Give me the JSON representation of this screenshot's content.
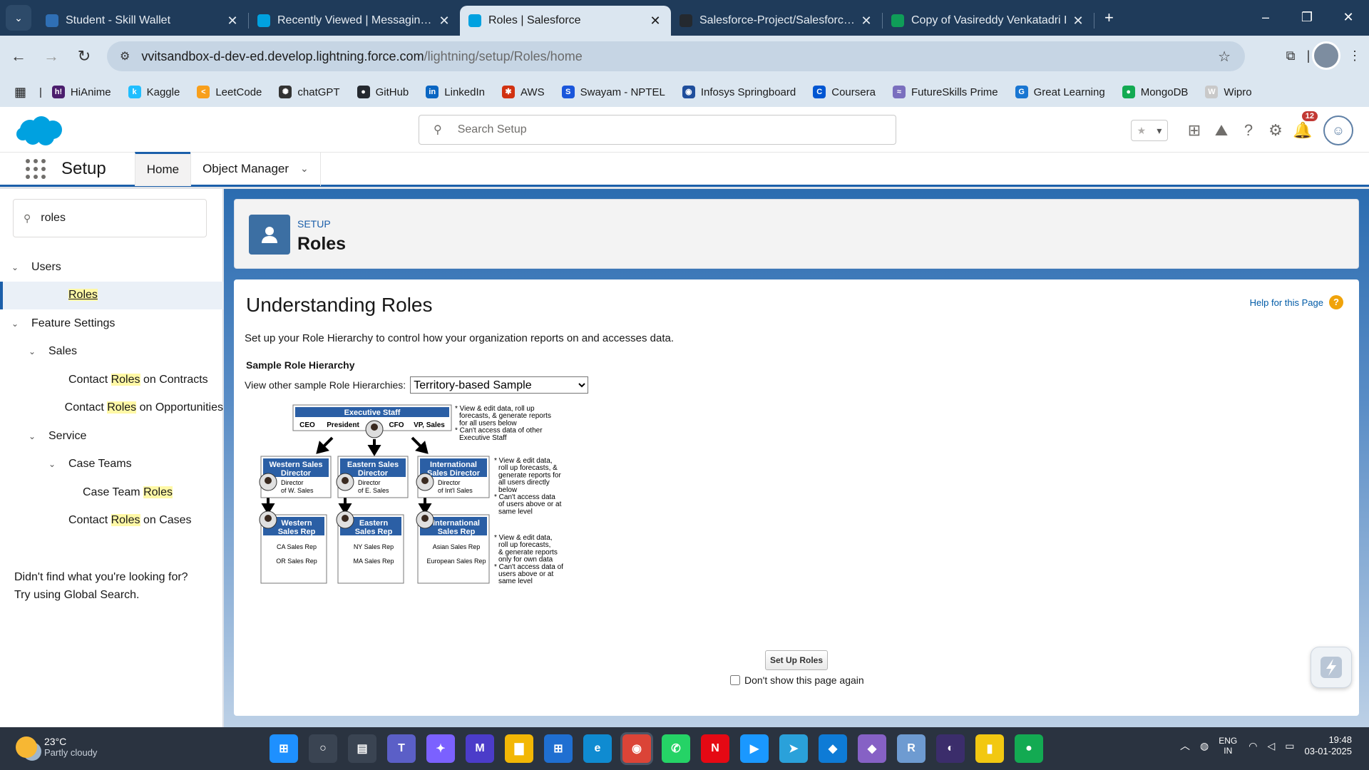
{
  "browser": {
    "tabs": [
      {
        "title": "Student - Skill Wallet",
        "color": "#2f6fb5"
      },
      {
        "title": "Recently Viewed | Messaging U",
        "color": "#00a1e0"
      },
      {
        "title": "Roles | Salesforce",
        "color": "#00a1e0",
        "active": true
      },
      {
        "title": "Salesforce-Project/Salesforce P",
        "color": "#24292f"
      },
      {
        "title": "Copy of Vasireddy Venkatadri I",
        "color": "#0f9d58"
      }
    ],
    "new_tab": "+",
    "url_host": "vvitsandbox-d-dev-ed.develop.lightning.force.com",
    "url_path": "/lightning/setup/Roles/home",
    "bookmarks": [
      {
        "label": "HiAnime",
        "color": "#4b1e6d",
        "icon": "h!"
      },
      {
        "label": "Kaggle",
        "color": "#20beff",
        "icon": "k"
      },
      {
        "label": "LeetCode",
        "color": "#f89f1b",
        "icon": "<"
      },
      {
        "label": "chatGPT",
        "color": "#333333",
        "icon": "✺"
      },
      {
        "label": "GitHub",
        "color": "#24292f",
        "icon": "●"
      },
      {
        "label": "LinkedIn",
        "color": "#0a66c2",
        "icon": "in"
      },
      {
        "label": "AWS",
        "color": "#d13212",
        "icon": "✱"
      },
      {
        "label": "Swayam - NPTEL",
        "color": "#1a56db",
        "icon": "S"
      },
      {
        "label": "Infosys Springboard",
        "color": "#1f4e9c",
        "icon": "◉"
      },
      {
        "label": "Coursera",
        "color": "#0056d2",
        "icon": "C"
      },
      {
        "label": "FutureSkills Prime",
        "color": "#7a6fbe",
        "icon": "≈"
      },
      {
        "label": "Great Learning",
        "color": "#1976d2",
        "icon": "G"
      },
      {
        "label": "MongoDB",
        "color": "#13aa52",
        "icon": "●"
      },
      {
        "label": "Wipro",
        "color": "#c9c9c9",
        "icon": "W"
      }
    ]
  },
  "salesforce": {
    "search_placeholder": "Search Setup",
    "notification_count": "12",
    "app_name": "Setup",
    "nav_tabs": [
      {
        "label": "Home"
      },
      {
        "label": "Object Manager"
      }
    ]
  },
  "sidebar": {
    "quick_find_value": "roles",
    "tree": [
      {
        "level": 0,
        "toggle": "⌄",
        "pre": "Users",
        "hl": "",
        "post": ""
      },
      {
        "level": 2,
        "toggle": "",
        "pre": "",
        "hl": "Roles",
        "post": "",
        "selected": true
      },
      {
        "level": 0,
        "toggle": "⌄",
        "pre": "Feature Settings",
        "hl": "",
        "post": ""
      },
      {
        "level": 1,
        "toggle": "⌄",
        "pre": "Sales",
        "hl": "",
        "post": ""
      },
      {
        "level": 2,
        "toggle": "",
        "pre": "Contact ",
        "hl": "Roles",
        "post": " on Contracts"
      },
      {
        "level": 2,
        "toggle": "",
        "pre": "Contact ",
        "hl": "Roles",
        "post": " on Opportunities"
      },
      {
        "level": 1,
        "toggle": "⌄",
        "pre": "Service",
        "hl": "",
        "post": ""
      },
      {
        "level": 2,
        "toggle": "⌄",
        "pre": "Case Teams",
        "hl": "",
        "post": ""
      },
      {
        "level": 3,
        "toggle": "",
        "pre": "Case Team ",
        "hl": "Roles",
        "post": ""
      },
      {
        "level": 2,
        "toggle": "",
        "pre": "Contact ",
        "hl": "Roles",
        "post": " on Cases"
      }
    ],
    "no_result_line1": "Didn't find what you're looking for?",
    "no_result_line2": "Try using Global Search."
  },
  "page_header": {
    "eyebrow": "SETUP",
    "title": "Roles"
  },
  "content": {
    "title": "Understanding Roles",
    "help_link": "Help for this Page",
    "intro": "Set up your Role Hierarchy to control how your organization reports on and accesses data.",
    "sample_heading": "Sample Role Hierarchy",
    "view_label": "View other sample Role Hierarchies:",
    "select_value": "Territory-based Sample",
    "setup_button": "Set Up Roles",
    "dont_show": "Don't show this page again",
    "diagram": {
      "exec_title": "Executive Staff",
      "exec_roles": [
        "CEO",
        "President",
        "CFO",
        "VP, Sales"
      ],
      "exec_notes": [
        "* View & edit data, roll up",
        "forecasts, & generate reports",
        "for all users below",
        "* Can't access data of other",
        "Executive Staff"
      ],
      "directors": [
        {
          "title1": "Western Sales",
          "title2": "Director",
          "sub1": "Director",
          "sub2": "of W. Sales"
        },
        {
          "title1": "Eastern Sales",
          "title2": "Director",
          "sub1": "Director",
          "sub2": "of E. Sales"
        },
        {
          "title1": "International",
          "title2": "Sales Director",
          "sub1": "Director",
          "sub2": "of Int'l Sales"
        }
      ],
      "director_notes": [
        "* View & edit data,",
        "roll up forecasts, &",
        "generate reports for",
        "all users directly",
        "below",
        "* Can't access data",
        "of users above or at",
        "same level"
      ],
      "reps": [
        {
          "title1": "Western",
          "title2": "Sales Rep",
          "sub1": "CA Sales Rep",
          "sub2": "OR Sales Rep"
        },
        {
          "title1": "Eastern",
          "title2": "Sales Rep",
          "sub1": "NY Sales Rep",
          "sub2": "MA Sales Rep"
        },
        {
          "title1": "International",
          "title2": "Sales Rep",
          "sub1": "Asian Sales Rep",
          "sub2": "European Sales Rep"
        }
      ],
      "rep_notes": [
        "* View & edit data,",
        "roll up forecasts,",
        "& generate reports",
        "only for own data",
        "* Can't access data of",
        "users above or at",
        "same level"
      ]
    }
  },
  "taskbar": {
    "temp": "23°C",
    "weather": "Partly cloudy",
    "lang1": "ENG",
    "lang2": "IN",
    "time": "19:48",
    "date": "03-01-2025",
    "apps": [
      {
        "name": "windows-start",
        "color": "#1e90ff",
        "glyph": "⊞"
      },
      {
        "name": "search",
        "color": "#3a4452",
        "glyph": "○"
      },
      {
        "name": "file-manager",
        "color": "#3a4452",
        "glyph": "▤"
      },
      {
        "name": "teams",
        "color": "#5b5fc7",
        "glyph": "T"
      },
      {
        "name": "copilot",
        "color": "#7b61ff",
        "glyph": "✦"
      },
      {
        "name": "notes-app",
        "color": "#4b3cc9",
        "glyph": "M"
      },
      {
        "name": "folder",
        "color": "#f2b705",
        "glyph": "▇"
      },
      {
        "name": "store",
        "color": "#1f6fd1",
        "glyph": "⊞"
      },
      {
        "name": "edge",
        "color": "#0f8bd1",
        "glyph": "e"
      },
      {
        "name": "chrome",
        "color": "#db4437",
        "glyph": "◉"
      },
      {
        "name": "whatsapp",
        "color": "#25d366",
        "glyph": "✆"
      },
      {
        "name": "netflix",
        "color": "#e50914",
        "glyph": "N"
      },
      {
        "name": "prime-video",
        "color": "#1a98ff",
        "glyph": "▶"
      },
      {
        "name": "telegram",
        "color": "#2aa1da",
        "glyph": "➤"
      },
      {
        "name": "vscode",
        "color": "#0e7bd6",
        "glyph": "◆"
      },
      {
        "name": "visual-studio",
        "color": "#8661c5",
        "glyph": "◆"
      },
      {
        "name": "r-lang",
        "color": "#6e9bd1",
        "glyph": "R"
      },
      {
        "name": "eclipse",
        "color": "#3b2d6b",
        "glyph": "◐"
      },
      {
        "name": "power-bi",
        "color": "#f2c811",
        "glyph": "▮"
      },
      {
        "name": "mongodb-compass",
        "color": "#13aa52",
        "glyph": "●"
      }
    ]
  }
}
